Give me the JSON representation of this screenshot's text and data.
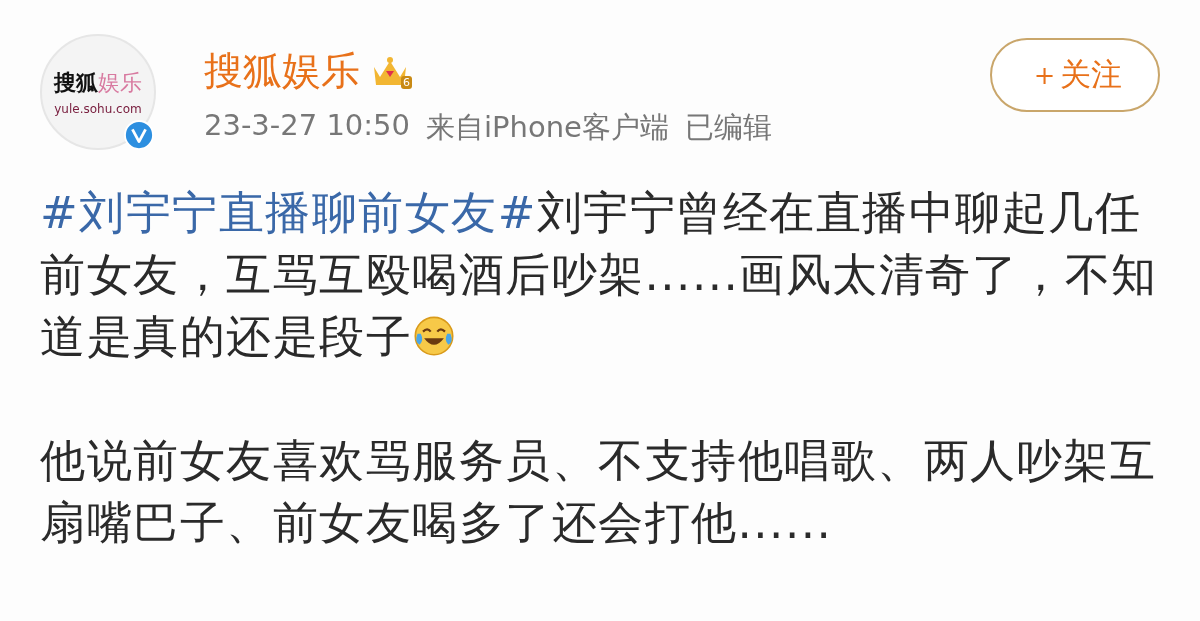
{
  "post": {
    "avatar": {
      "logo_dark": "搜狐",
      "logo_pink": "娱乐",
      "domain": "yule.sohu.com",
      "verified": true
    },
    "author": "搜狐娱乐",
    "member_level": "6",
    "meta": {
      "time": "23-3-27 10:50",
      "source": "来自iPhone客户端",
      "edited": "已编辑"
    },
    "follow_button": "＋关注",
    "paragraphs": [
      {
        "kind": "with_emoji",
        "hashtag": "#刘宇宁直播聊前女友#",
        "text": "刘宇宁曾经在直播中聊起几任前女友，互骂互殴喝酒后吵架......画风太清奇了，不知道是真的还是段子"
      },
      {
        "kind": "plain",
        "text": "他说前女友喜欢骂服务员、不支持他唱歌、两人吵架互扇嘴巴子、前女友喝多了还会打他......"
      }
    ]
  }
}
